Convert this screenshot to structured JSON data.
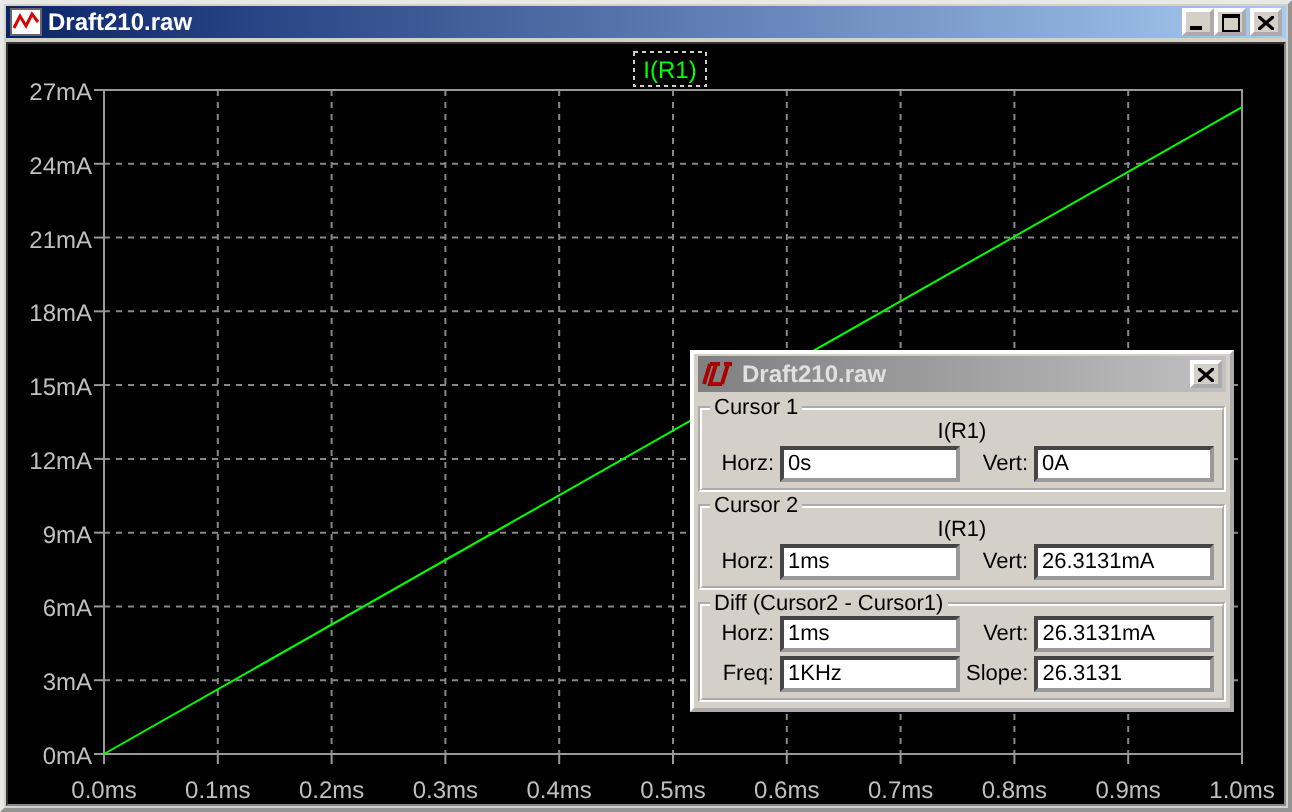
{
  "window": {
    "title": "Draft210.raw"
  },
  "plot": {
    "chart_data": {
      "type": "line",
      "x": [
        0,
        1
      ],
      "series": [
        {
          "name": "I(R1)",
          "color": "#00ff00",
          "values": [
            0,
            26.3
          ]
        }
      ],
      "grid": true,
      "xlim": [
        0,
        1
      ],
      "ylim": [
        0,
        27
      ],
      "xticks": [
        {
          "value": 0,
          "label": "0.0ms"
        },
        {
          "value": 0.1,
          "label": "0.1ms"
        },
        {
          "value": 0.2,
          "label": "0.2ms"
        },
        {
          "value": 0.3,
          "label": "0.3ms"
        },
        {
          "value": 0.4,
          "label": "0.4ms"
        },
        {
          "value": 0.5,
          "label": "0.5ms"
        },
        {
          "value": 0.6,
          "label": "0.6ms"
        },
        {
          "value": 0.7,
          "label": "0.7ms"
        },
        {
          "value": 0.8,
          "label": "0.8ms"
        },
        {
          "value": 0.9,
          "label": "0.9ms"
        },
        {
          "value": 1,
          "label": "1.0ms"
        }
      ],
      "yticks": [
        {
          "value": 0,
          "label": "0mA"
        },
        {
          "value": 3,
          "label": "3mA"
        },
        {
          "value": 6,
          "label": "6mA"
        },
        {
          "value": 9,
          "label": "9mA"
        },
        {
          "value": 12,
          "label": "12mA"
        },
        {
          "value": 15,
          "label": "15mA"
        },
        {
          "value": 18,
          "label": "18mA"
        },
        {
          "value": 21,
          "label": "21mA"
        },
        {
          "value": 24,
          "label": "24mA"
        },
        {
          "value": 27,
          "label": "27mA"
        }
      ]
    }
  },
  "cursor_dialog": {
    "title": "Draft210.raw",
    "groups": [
      {
        "label": "Cursor 1",
        "trace": "I(R1)",
        "fields": [
          {
            "label": "Horz:",
            "value": "0s"
          },
          {
            "label": "Vert:",
            "value": "0A"
          }
        ]
      },
      {
        "label": "Cursor 2",
        "trace": "I(R1)",
        "fields": [
          {
            "label": "Horz:",
            "value": "1ms"
          },
          {
            "label": "Vert:",
            "value": "26.3131mA"
          }
        ]
      },
      {
        "label": "Diff (Cursor2 - Cursor1)",
        "fields": [
          {
            "label": "Horz:",
            "value": "1ms"
          },
          {
            "label": "Vert:",
            "value": "26.3131mA"
          },
          {
            "label": "Freq:",
            "value": "1KHz"
          },
          {
            "label": "Slope:",
            "value": "26.3131"
          }
        ]
      }
    ]
  }
}
